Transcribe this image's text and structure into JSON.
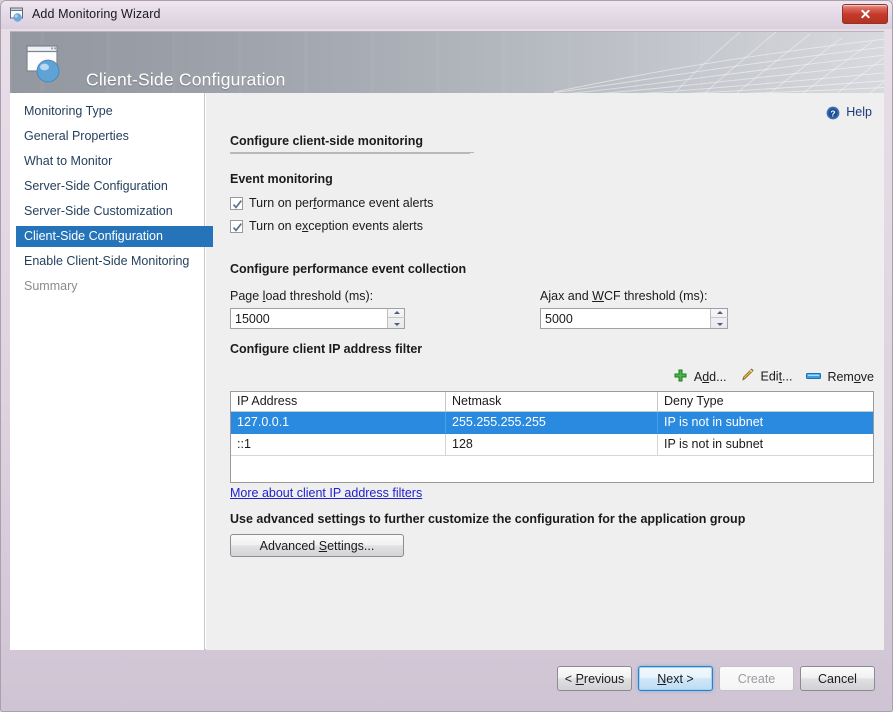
{
  "window": {
    "title": "Add Monitoring Wizard",
    "titlebar_icon": "window-sphere-icon",
    "close_label": "Close",
    "close_icon": "close-icon",
    "accent_selected": "#2573b8",
    "accent_row_selected": "#2a8ae0",
    "close_button_color": "#c43a2c"
  },
  "banner": {
    "title": "Client-Side Configuration",
    "icon": "window-sphere-icon"
  },
  "sidebar": {
    "items": [
      {
        "label": "Monitoring Type",
        "state": "normal"
      },
      {
        "label": "General Properties",
        "state": "normal"
      },
      {
        "label": "What to Monitor",
        "state": "normal"
      },
      {
        "label": "Server-Side Configuration",
        "state": "normal"
      },
      {
        "label": "Server-Side Customization",
        "state": "normal"
      },
      {
        "label": "Client-Side Configuration",
        "state": "selected"
      },
      {
        "label": "Enable Client-Side Monitoring",
        "state": "normal"
      },
      {
        "label": "Summary",
        "state": "disabled"
      }
    ]
  },
  "help": {
    "label": "Help",
    "icon": "help-circle-icon"
  },
  "main": {
    "heading": "Configure client-side monitoring",
    "event_monitoring": {
      "heading": "Event monitoring",
      "checkboxes": [
        {
          "label_pre": "Turn on per",
          "accel": "f",
          "label_post": "ormance event alerts",
          "checked": true
        },
        {
          "label_pre": "Turn on e",
          "accel": "x",
          "label_post": "ception events alerts",
          "checked": true
        }
      ]
    },
    "performance_collection": {
      "heading": "Configure performance event collection",
      "page_load": {
        "label_pre": "Page ",
        "accel": "l",
        "label_post": "oad threshold (ms):",
        "value": "15000"
      },
      "ajax_wcf": {
        "label_pre": "Ajax and ",
        "accel": "W",
        "label_post": "CF threshold (ms):",
        "value": "5000"
      }
    },
    "ip_filter": {
      "heading": "Configure client IP address filter",
      "toolbar": [
        {
          "label_pre": "A",
          "accel": "d",
          "label_post": "d...",
          "icon": "plus-icon"
        },
        {
          "label_pre": "Edi",
          "accel": "t",
          "label_post": "...",
          "icon": "pencil-icon"
        },
        {
          "label_pre": "Rem",
          "accel": "o",
          "label_post": "ve",
          "icon": "minus-bar-icon"
        }
      ],
      "columns": [
        "IP Address",
        "Netmask",
        "Deny Type"
      ],
      "rows": [
        {
          "cells": [
            "127.0.0.1",
            "255.255.255.255",
            "IP is not in subnet"
          ],
          "selected": true
        },
        {
          "cells": [
            "::1",
            "128",
            "IP is not in subnet"
          ],
          "selected": false
        }
      ],
      "more_link": "More about client IP address filters"
    },
    "advanced": {
      "heading": "Use advanced settings to further customize the configuration for the application group",
      "button_pre": "Advanced ",
      "button_accel": "S",
      "button_post": "ettings..."
    }
  },
  "footer": {
    "previous": {
      "pre": "< ",
      "accel": "P",
      "post": "revious"
    },
    "next": {
      "pre": "",
      "accel": "N",
      "post": "ext >"
    },
    "create": {
      "pre": "Create",
      "accel": "",
      "post": ""
    },
    "cancel": {
      "pre": "Cancel",
      "accel": "",
      "post": ""
    }
  }
}
